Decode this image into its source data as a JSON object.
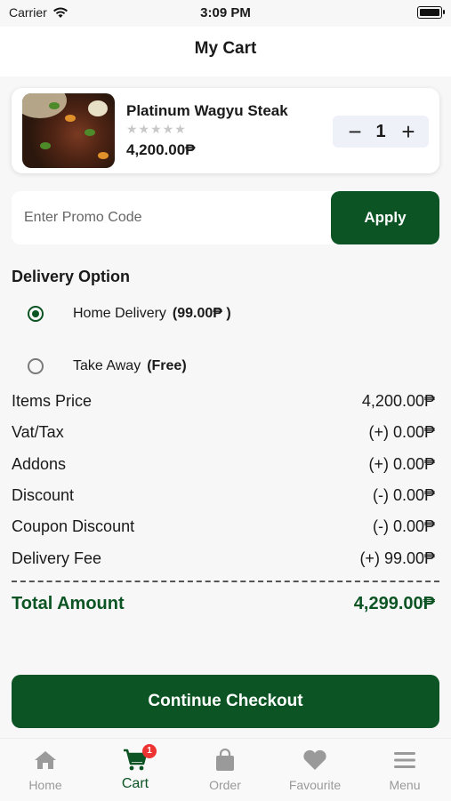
{
  "status_bar": {
    "carrier": "Carrier",
    "time": "3:09 PM"
  },
  "header": {
    "title": "My Cart"
  },
  "cart_item": {
    "name": "Platinum Wagyu Steak",
    "stars": "★★★★★",
    "rating": 0,
    "price": "4,200.00₱",
    "quantity": "1",
    "minus": "−",
    "plus": "+"
  },
  "promo": {
    "placeholder": "Enter Promo Code",
    "value": "",
    "apply_label": "Apply"
  },
  "delivery": {
    "title": "Delivery Option",
    "options": [
      {
        "label": "Home Delivery",
        "extra": "(99.00₱ )",
        "selected": true
      },
      {
        "label": "Take Away",
        "extra": "(Free)",
        "selected": false
      }
    ]
  },
  "summary": {
    "rows": [
      {
        "label": "Items Price",
        "value": "4,200.00₱"
      },
      {
        "label": "Vat/Tax",
        "value": "(+) 0.00₱"
      },
      {
        "label": "Addons",
        "value": "(+) 0.00₱"
      },
      {
        "label": "Discount",
        "value": "(-) 0.00₱"
      },
      {
        "label": "Coupon Discount",
        "value": "(-) 0.00₱"
      },
      {
        "label": "Delivery Fee",
        "value": "(+) 99.00₱"
      }
    ],
    "total_label": "Total Amount",
    "total_value": "4,299.00₱"
  },
  "checkout": {
    "label": "Continue Checkout"
  },
  "bottom_nav": {
    "items": [
      {
        "label": "Home",
        "icon": "home-icon"
      },
      {
        "label": "Cart",
        "icon": "cart-icon",
        "badge": "1",
        "active": true
      },
      {
        "label": "Order",
        "icon": "bag-icon"
      },
      {
        "label": "Favourite",
        "icon": "heart-icon"
      },
      {
        "label": "Menu",
        "icon": "menu-icon"
      }
    ]
  },
  "colors": {
    "primary": "#0c5424",
    "badge": "#e33333",
    "inactive": "#9a9a9a",
    "background": "#f7f7f7"
  }
}
